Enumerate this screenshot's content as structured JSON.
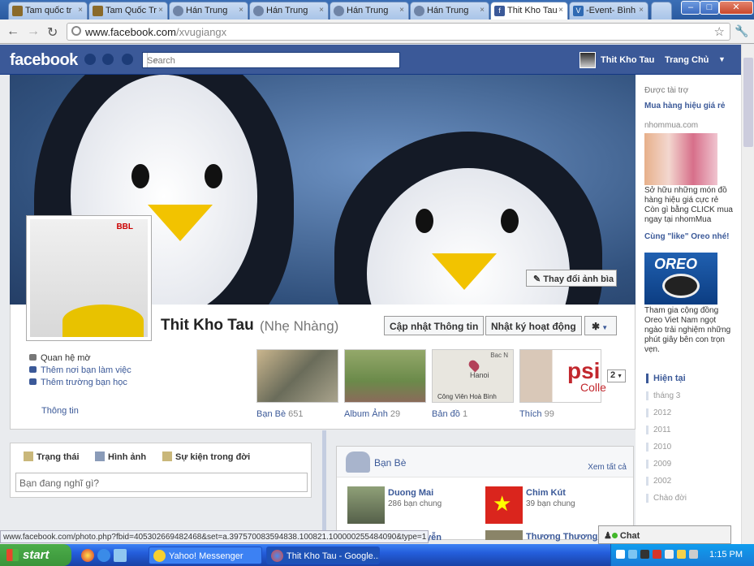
{
  "browser": {
    "tabs": [
      {
        "label": "Tam quốc tr",
        "icon": "game-favicon-icon",
        "color": "#8a6a2a"
      },
      {
        "label": "Tam Quốc Tr",
        "icon": "game-favicon-icon",
        "color": "#8a6a2a"
      },
      {
        "label": "Hán Trung",
        "icon": "globe-favicon-icon",
        "color": "#6f84a6"
      },
      {
        "label": "Hán Trung",
        "icon": "globe-favicon-icon",
        "color": "#6f84a6"
      },
      {
        "label": "Hán Trung",
        "icon": "globe-favicon-icon",
        "color": "#6f84a6"
      },
      {
        "label": "Hán Trung",
        "icon": "globe-favicon-icon",
        "color": "#6f84a6"
      },
      {
        "label": "Thit Kho Tau",
        "icon": "facebook-favicon-icon",
        "color": "#3b5998",
        "active": true
      },
      {
        "label": "-Event- Bình",
        "icon": "vforum-favicon-icon",
        "color": "#2f6ab3"
      }
    ],
    "url_host": "www.facebook.com",
    "url_path": "/xvugiangx"
  },
  "fb": {
    "logo": "facebook",
    "search_placeholder": "Search",
    "user_name": "Thit Kho Tau",
    "home": "Trang Chủ",
    "brand_color": "#3b5998"
  },
  "cover": {
    "change_cover": "Thay đổi ảnh bìa",
    "badge": "BBL"
  },
  "profile": {
    "name": "Thit Kho Tau",
    "nickname": "(Nhẹ Nhàng)",
    "update_info": "Cập nhật Thông tin",
    "activity_log": "Nhật ký hoạt động",
    "info_items": [
      {
        "label": "Quan hệ mờ",
        "link": false
      },
      {
        "label": "Thêm nơi bạn làm việc",
        "link": true
      },
      {
        "label": "Thêm trường bạn học",
        "link": true
      }
    ],
    "info_link": "Thông tin",
    "thumbs": [
      {
        "label": "Bạn Bè",
        "count": "651"
      },
      {
        "label": "Album Ảnh",
        "count": "29"
      },
      {
        "label": "Bản đồ",
        "count": "1"
      },
      {
        "label": "Thích",
        "count": "99"
      }
    ],
    "map_text": "Hanoi",
    "map_caption": "Công Viên Hoà Bình",
    "map_corner": "Bac N",
    "likes_logo": "psi",
    "likes_sub": "Colle",
    "more_count": "2"
  },
  "composer": {
    "tabs": [
      "Trạng thái",
      "Hình ảnh",
      "Sự kiện trong đời"
    ],
    "placeholder": "Bạn đang nghĩ gì?"
  },
  "friends_box": {
    "title": "Bạn Bè",
    "see_all": "Xem tất cả",
    "items": [
      {
        "name": "Duong Mai",
        "mutual": "286 bạn chung"
      },
      {
        "name": "Chim Kút",
        "mutual": "39 bạn chung"
      },
      {
        "name": "yễn",
        "mutual": ""
      },
      {
        "name": "Thương Thương M",
        "mutual": ""
      }
    ]
  },
  "sidebar": {
    "sponsored": "Được tài trợ",
    "ads": [
      {
        "title": "Mua hàng hiệu giá rẻ",
        "url": "nhommua.com",
        "text": "Sở hữu những món đồ hàng hiệu giá cực rẻ Còn gì bằng CLICK mua ngay tại nhomMua"
      },
      {
        "title": "Cùng \"like\" Oreo nhé!",
        "url": "",
        "text": "Tham gia cộng đồng Oreo Viet Nam ngọt ngào trải nghiệm những phút giây bên con trọn vẹn.",
        "brand": "OREO"
      }
    ],
    "timeline": [
      "Hiện tại",
      "tháng 3",
      "2012",
      "2011",
      "2010",
      "2009",
      "2002",
      "Chào đời"
    ]
  },
  "status_url": "www.facebook.com/photo.php?fbid=405302669482468&set=a.397570083594838.100821.100000255484090&type=1",
  "chat": "Chat",
  "taskbar": {
    "start": "start",
    "tasks": [
      "Yahoo! Messenger",
      "Thit Kho Tau - Google..."
    ],
    "clock": "1:15 PM"
  }
}
